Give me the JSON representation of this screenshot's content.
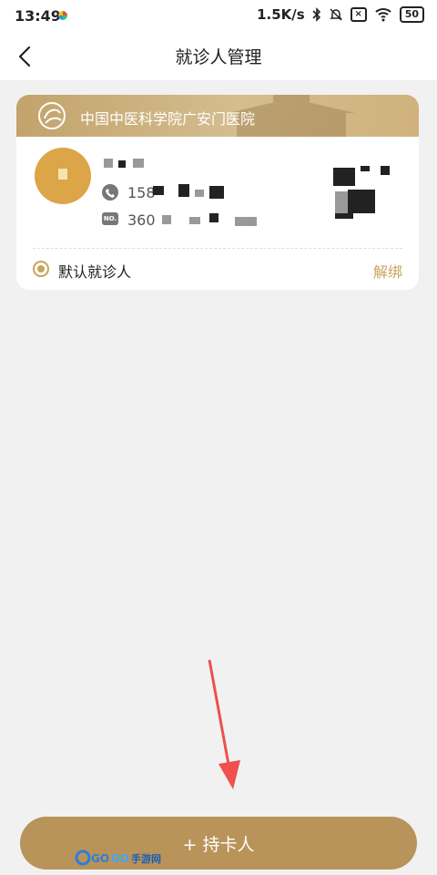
{
  "status_bar": {
    "time": "13:49",
    "network_speed": "1.5K/s",
    "battery": "50",
    "icons": [
      "bluetooth-icon",
      "mute-icon",
      "sim-x-icon",
      "wifi-icon",
      "battery-icon"
    ]
  },
  "nav": {
    "title": "就诊人管理",
    "back_icon": "chevron-left-icon"
  },
  "card": {
    "hospital_name": "中国中医科学院广安门医院",
    "patient": {
      "name": "",
      "phone": "158",
      "id_number": "360"
    },
    "default_label": "默认就诊人",
    "unbind_label": "解绑"
  },
  "footer": {
    "add_card_label": "+ 持卡人"
  },
  "colors": {
    "accent": "#c9a25a",
    "button": "#b8935a",
    "avatar": "#dca547",
    "arrow": "#ee4f4f"
  }
}
